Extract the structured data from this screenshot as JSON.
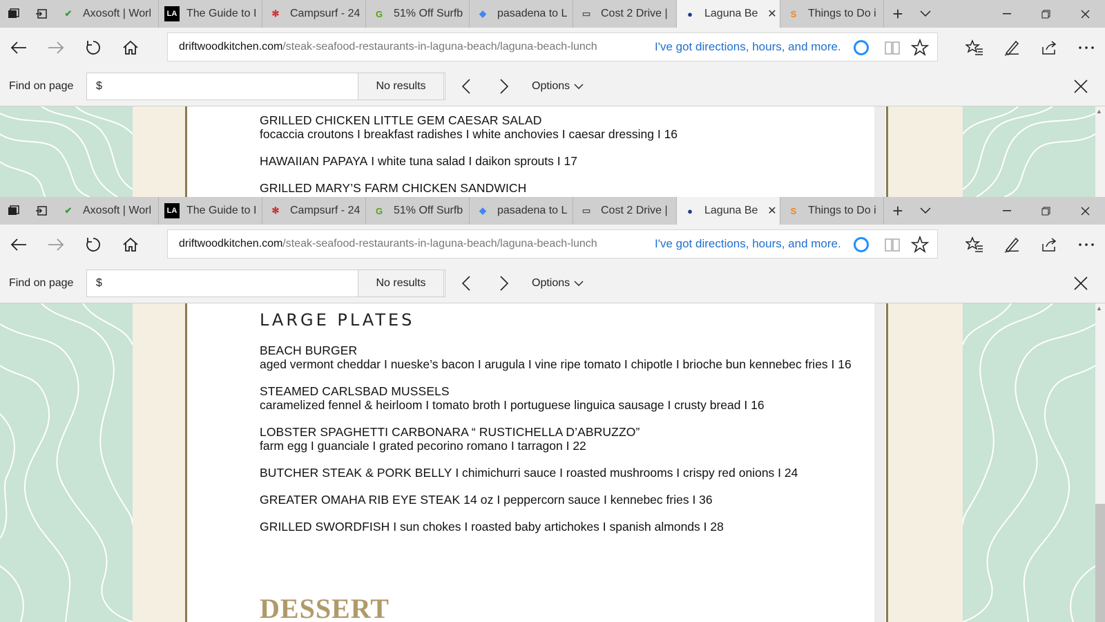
{
  "browser": {
    "tabs": [
      {
        "title": "Axosoft | Worl",
        "icon": "axosoft-icon",
        "icon_color": "#3a9b3a"
      },
      {
        "title": "The Guide to I",
        "icon": "la-icon",
        "icon_color": "#000000"
      },
      {
        "title": "Campsurf - 24",
        "icon": "yelp-icon",
        "icon_color": "#d32323"
      },
      {
        "title": "51% Off Surfb",
        "icon": "groupon-icon",
        "icon_color": "#53a318"
      },
      {
        "title": "pasadena to L",
        "icon": "maps-icon",
        "icon_color": "#4285f4"
      },
      {
        "title": "Cost 2 Drive |",
        "icon": "page-icon",
        "icon_color": "#555555"
      },
      {
        "title": "Laguna Be",
        "icon": "globe-icon",
        "icon_color": "#1d3b8a",
        "active": true,
        "close": "✕"
      },
      {
        "title": "Things to Do i",
        "icon": "s-icon",
        "icon_color": "#f58220"
      }
    ],
    "new_tab": "+",
    "address": {
      "host": "driftwoodkitchen.com",
      "path": "/steak-seafood-restaurants-in-laguna-beach/laguna-beach-lunch",
      "hint": "I've got directions, hours, and more."
    },
    "find": {
      "label": "Find on page",
      "value": "$",
      "results": "No results",
      "options_label": "Options"
    }
  },
  "top_menu": {
    "dishes": [
      {
        "name": "GRILLED CHICKEN LITTLE GEM CAESAR SALAD",
        "desc": "focaccia croutons  I  breakfast radishes  I  white anchovies  I  caesar dressing  I  16"
      },
      {
        "name": "HAWAIIAN PAPAYA",
        "desc": "  I  white tuna salad  I  daikon sprouts  I  17"
      },
      {
        "name": "GRILLED MARY’S FARM CHICKEN SANDWICH",
        "desc": ""
      }
    ]
  },
  "bottom_menu": {
    "section_title": "LARGE PLATES",
    "dishes": [
      {
        "name": "BEACH BURGER",
        "desc": "aged vermont cheddar  I  nueske’s bacon  I  arugula  I  vine ripe tomato  I  chipotle  I  brioche bun kennebec fries  I  16",
        "inline": false
      },
      {
        "name": "STEAMED CARLSBAD MUSSELS",
        "desc": "caramelized fennel & heirloom   I  tomato broth  I  portuguese linguica sausage  I  crusty bread  I  16",
        "inline": false
      },
      {
        "name": "LOBSTER SPAGHETTI CARBONARA “ RUSTICHELLA D’ABRUZZO”",
        "desc": "farm egg  I  guanciale  I  grated pecorino romano  I  tarragon  I  22",
        "inline": false
      },
      {
        "name": "BUTCHER STEAK & PORK BELLY",
        "desc": "  I  chimichurri sauce  I  roasted mushrooms  I  crispy red onions  I  24",
        "inline": true
      },
      {
        "name": "GREATER OMAHA RIB EYE STEAK 14 oz",
        "desc": "  I  peppercorn sauce  I  kennebec fries  I  36",
        "inline": true
      },
      {
        "name": "GRILLED SWORDFISH",
        "desc": "  I  sun chokes  I  roasted baby artichokes  I  spanish almonds  I  28",
        "inline": true
      }
    ],
    "dessert_title": "DESSERT"
  }
}
